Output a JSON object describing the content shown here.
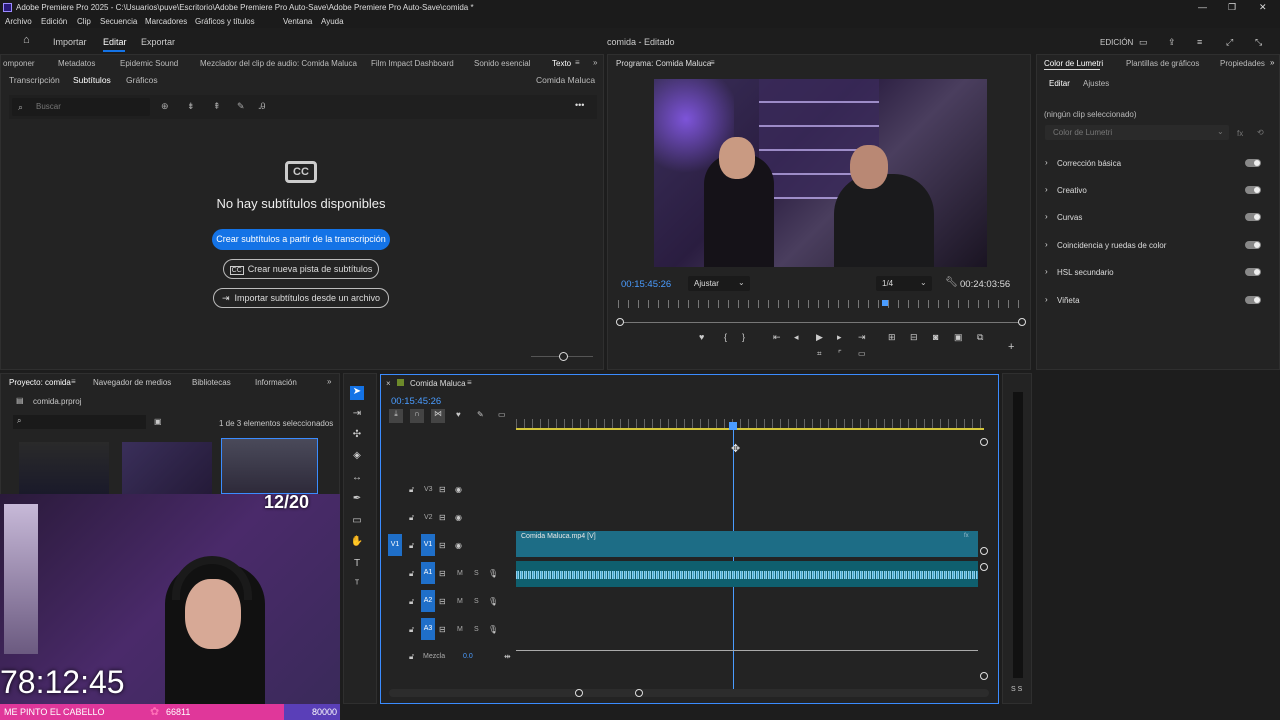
{
  "window": {
    "title": "Adobe Premiere Pro 2025 - C:\\Usuarios\\puve\\Escritorio\\Adobe Premiere Pro Auto-Save\\Adobe Premiere Pro Auto-Save\\comida *",
    "min": "—",
    "max": "❐",
    "close": "✕"
  },
  "menu": [
    "Archivo",
    "Edición",
    "Clip",
    "Secuencia",
    "Marcadores",
    "Gráficos y títulos",
    "Ventana",
    "Ayuda"
  ],
  "header": {
    "modes": [
      "Importar",
      "Editar",
      "Exportar"
    ],
    "project_title": "comida - Editado",
    "workspace": "EDICIÓN"
  },
  "top_left": {
    "tabs": [
      "omponer",
      "Metadatos",
      "Epidemic Sound",
      "Mezclador del clip de audio: Comida Maluca",
      "Film Impact Dashboard",
      "Sonido esencial",
      "Texto"
    ],
    "subtabs": [
      "Transcripción",
      "Subtítulos",
      "Gráficos"
    ],
    "sequence": "Comida Maluca",
    "search_placeholder": "Buscar",
    "cc": "CC",
    "empty_title": "No hay subtítulos disponibles",
    "btn_create": "Crear subtítulos a partir de la transcripción",
    "btn_new_track": "Crear nueva pista de subtítulos",
    "btn_import": "Importar subtítulos desde un archivo"
  },
  "program": {
    "title": "Programa: Comida Maluca",
    "timecode": "00:15:45:26",
    "fit": "Ajustar",
    "resolution": "1/4",
    "duration": "00:24:03:56",
    "playhead_fraction": 0.66
  },
  "lumetri": {
    "tabs": [
      "Color de Lumetri",
      "Plantillas de gráficos",
      "Propiedades"
    ],
    "subtabs": [
      "Editar",
      "Ajustes"
    ],
    "no_clip": "(ningún clip seleccionado)",
    "dropdown": "Color de Lumetri",
    "sections": [
      "Corrección básica",
      "Creativo",
      "Curvas",
      "Coincidencia y ruedas de color",
      "HSL secundario",
      "Viñeta"
    ]
  },
  "project": {
    "tabs": [
      "Proyecto: comida",
      "Navegador de medios",
      "Bibliotecas",
      "Información"
    ],
    "file": "comida.prproj",
    "selected": "1 de 3 elementos seleccionados"
  },
  "timeline": {
    "sequence": "Comida Maluca",
    "timecode": "00:15:45:26",
    "tracks_video": [
      "V3",
      "V2",
      "V1"
    ],
    "tracks_audio": [
      "A1",
      "A2",
      "A3"
    ],
    "mix_label": "Mezcla",
    "mix_value": "0.0",
    "clip_label": "Comida Maluca.mp4 [V]",
    "m": "M",
    "s": "S"
  },
  "overlay": {
    "counter": "12/20",
    "clock": "78:12:45",
    "goal_label": "ME PINTO EL CABELLO",
    "goal_current": "66811",
    "goal_target": "80000",
    "goal_fraction": 0.835
  },
  "meter": {
    "label": "S S"
  },
  "colors": {
    "accent": "#1473e6",
    "clip": "#1d6d86",
    "audio": "#0f5f6e",
    "goal_bar": "#e0379a",
    "goal_end": "#5a3fb8"
  }
}
